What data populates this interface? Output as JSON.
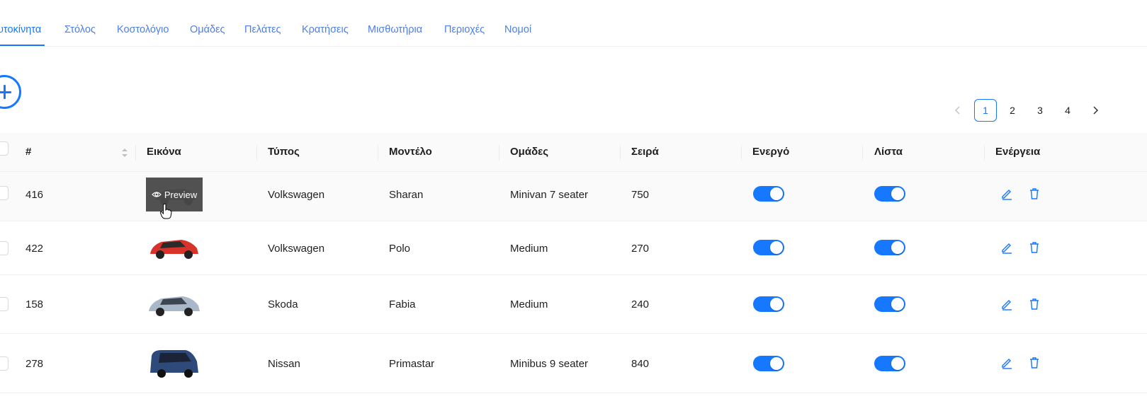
{
  "tabs": [
    {
      "label": "υτοκίνητα",
      "active": true
    },
    {
      "label": "Στόλος"
    },
    {
      "label": "Κοστολόγιο"
    },
    {
      "label": "Ομάδες"
    },
    {
      "label": "Πελάτες"
    },
    {
      "label": "Κρατήσεις"
    },
    {
      "label": "Μισθωτήρια"
    },
    {
      "label": "Περιοχές"
    },
    {
      "label": "Νομοί"
    }
  ],
  "pagination": {
    "pages": [
      "1",
      "2",
      "3",
      "4"
    ],
    "current": "1"
  },
  "table": {
    "columns": [
      "#",
      "Εικόνα",
      "Τύπος",
      "Μοντέλο",
      "Ομάδες",
      "Σειρά",
      "Ενεργό",
      "Λίστα",
      "Ενέργεια"
    ],
    "rows": [
      {
        "id": "416",
        "image": "dark-minivan",
        "type": "Volkswagen",
        "model": "Sharan",
        "group": "Minivan 7 seater",
        "order": "750",
        "active": true,
        "list": true
      },
      {
        "id": "422",
        "image": "red-hatchback",
        "type": "Volkswagen",
        "model": "Polo",
        "group": "Medium",
        "order": "270",
        "active": true,
        "list": true
      },
      {
        "id": "158",
        "image": "silver-hatchback",
        "type": "Skoda",
        "model": "Fabia",
        "group": "Medium",
        "order": "240",
        "active": true,
        "list": true
      },
      {
        "id": "278",
        "image": "blue-van",
        "type": "Nissan",
        "model": "Primastar",
        "group": "Minibus 9 seater",
        "order": "840",
        "active": true,
        "list": true
      }
    ]
  },
  "preview_label": "Preview",
  "colors": {
    "primary": "#1677ff",
    "header_bg": "#fafafa",
    "border": "#f0f0f0"
  }
}
